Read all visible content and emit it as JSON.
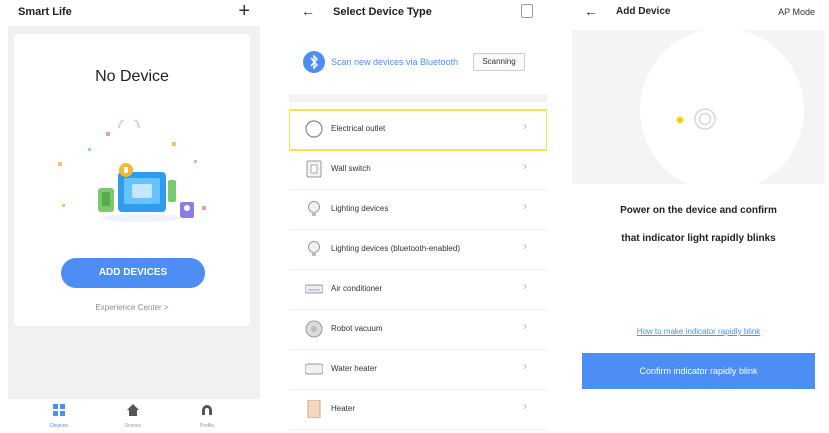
{
  "screen1": {
    "title": "Smart Life",
    "add_icon": "plus-icon",
    "empty_title": "No Device",
    "add_button": "ADD DEVICES",
    "experience_link": "Experience Center >",
    "nav": [
      {
        "label": "Devices",
        "icon": "grid-icon"
      },
      {
        "label": "Scenes",
        "icon": "home-icon"
      },
      {
        "label": "Profile",
        "icon": "profile-icon"
      }
    ],
    "accent": "#4c8ef4"
  },
  "screen2": {
    "title": "Select Device Type",
    "bluetooth_text": "Scan new devices via Bluetooth",
    "scan_button": "Scanning",
    "devices": [
      {
        "label": "Electrical outlet",
        "icon": "outlet-icon",
        "highlighted": true
      },
      {
        "label": "Wall switch",
        "icon": "switch-icon"
      },
      {
        "label": "Lighting devices",
        "icon": "bulb-icon"
      },
      {
        "label": "Lighting devices (bluetooth-enabled)",
        "icon": "bulb-icon"
      },
      {
        "label": "Air conditioner",
        "icon": "ac-icon"
      },
      {
        "label": "Robot vacuum",
        "icon": "vacuum-icon"
      },
      {
        "label": "Water heater",
        "icon": "water-heater-icon"
      },
      {
        "label": "Heater",
        "icon": "heater-icon"
      }
    ],
    "highlight_color": "#f2e84a"
  },
  "screen3": {
    "title": "Add Device",
    "mode": "AP Mode",
    "instruction_line1": "Power on the device and confirm",
    "instruction_line2": "that indicator light rapidly blinks",
    "help_link": "How to make indicator rapidly blink",
    "confirm_button": "Confirm indicator rapidly blink"
  }
}
